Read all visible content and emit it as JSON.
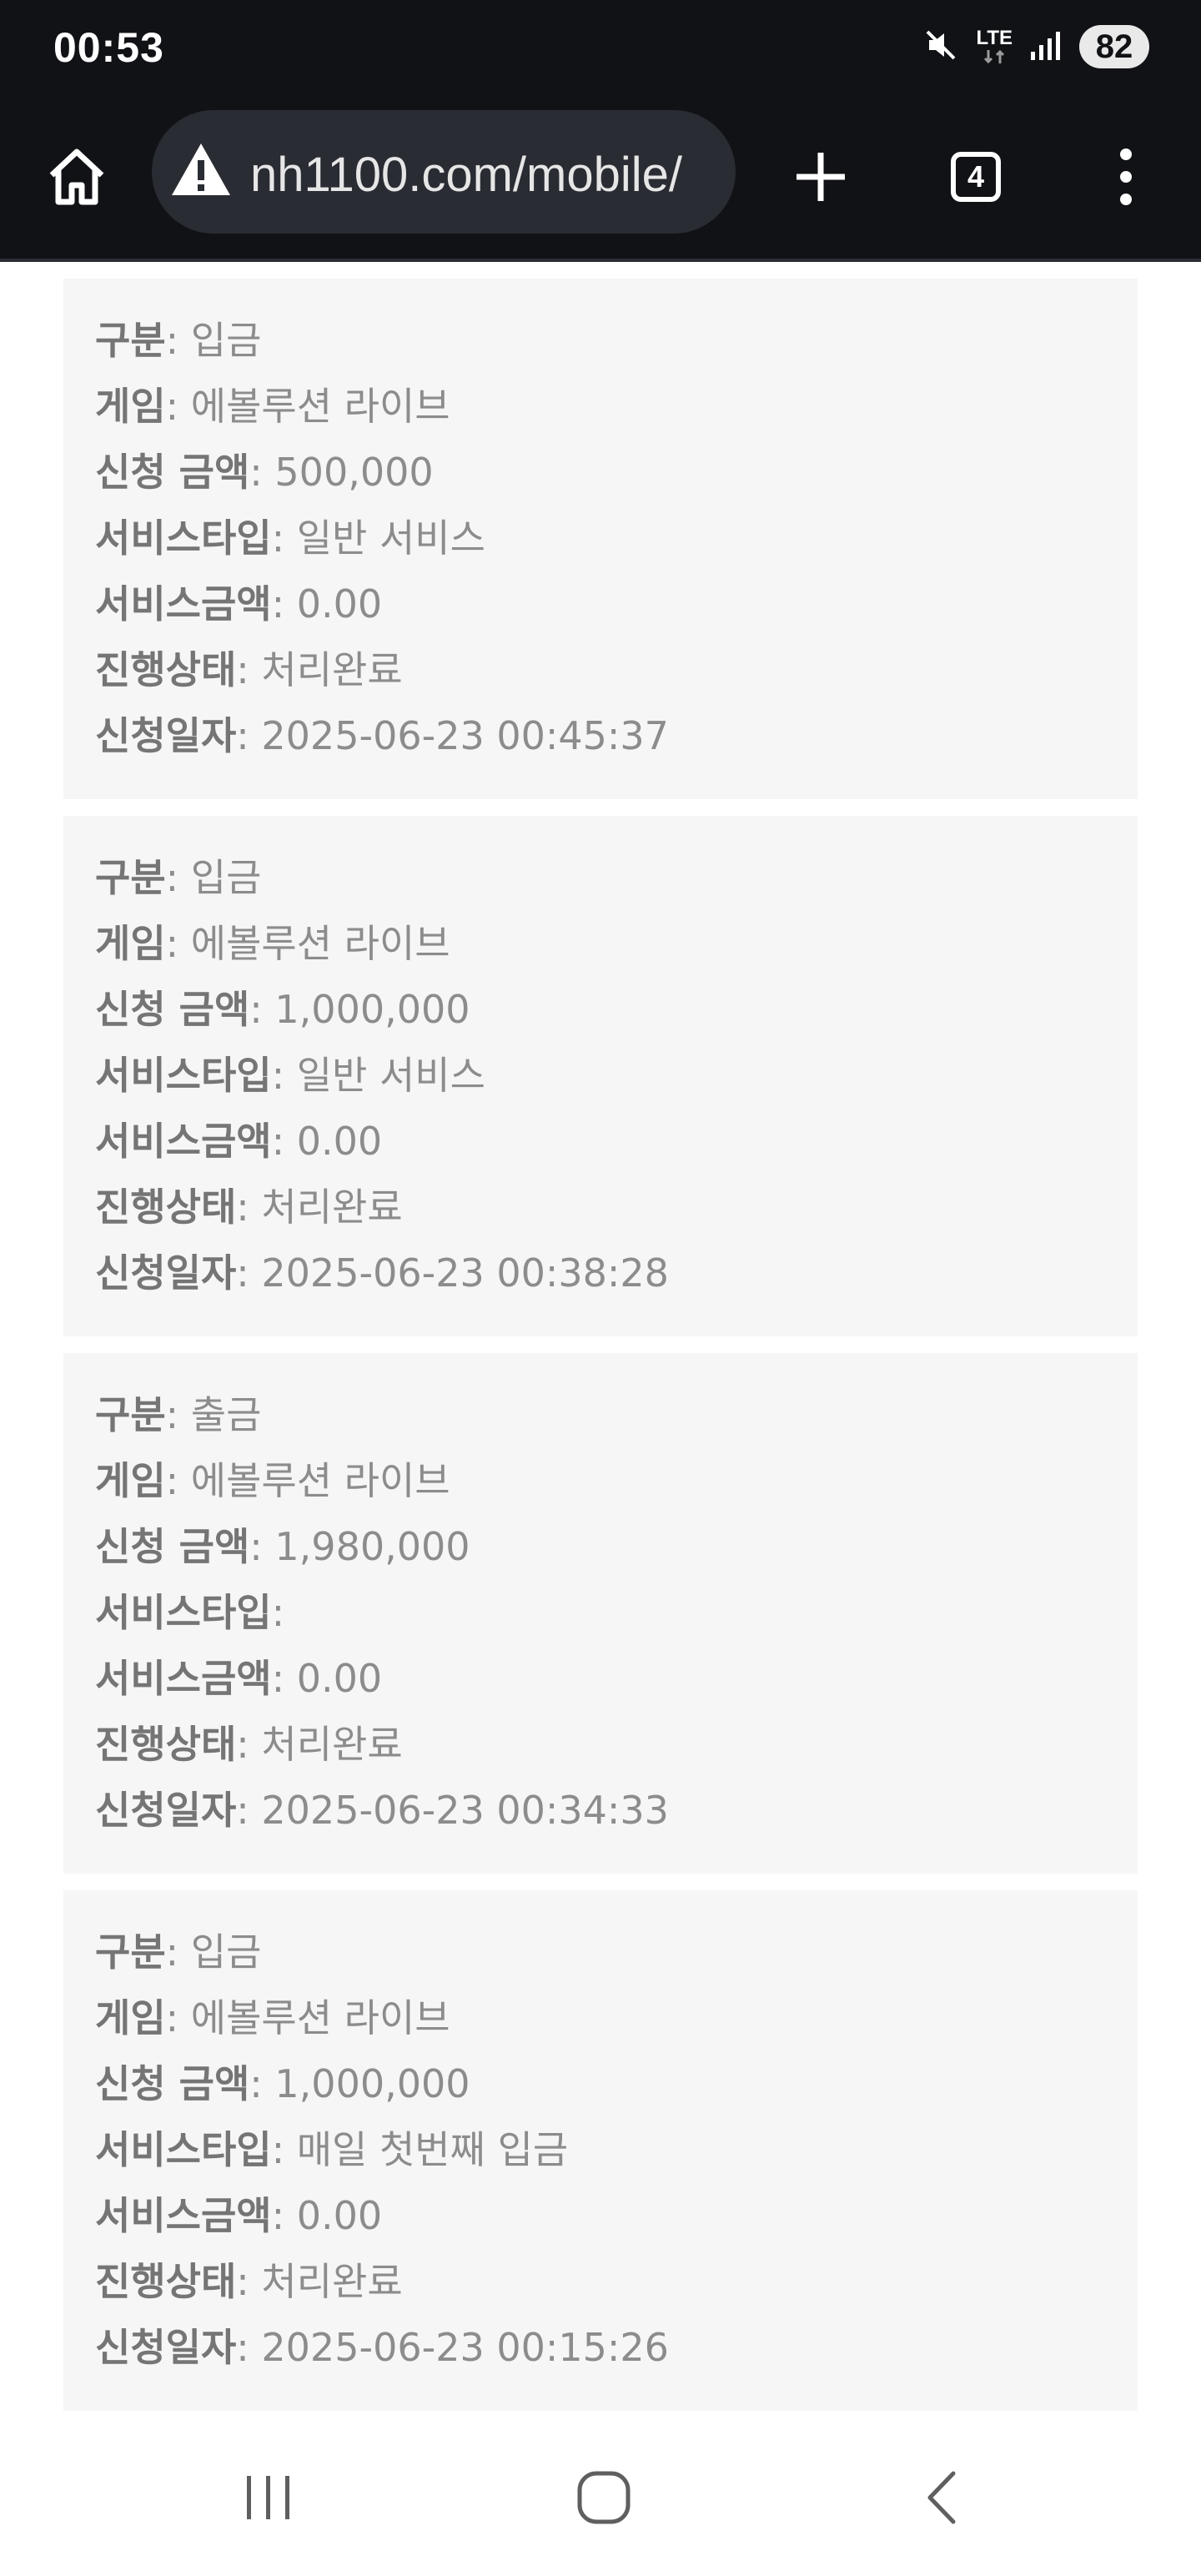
{
  "status_bar": {
    "time": "00:53",
    "network": "LTE",
    "battery": "82",
    "icons": [
      "mute-icon",
      "lte-icon",
      "signal-icon",
      "battery-icon"
    ]
  },
  "browser": {
    "url": "nh1100.com/mobile/",
    "tab_count": "4",
    "icons": [
      "home-icon",
      "warning-icon",
      "plus-icon",
      "tabs-icon",
      "more-vert-icon"
    ]
  },
  "labels": {
    "type": "구분",
    "game": "게임",
    "amount": "신청 금액",
    "service_type": "서비스타입",
    "service_amount": "서비스금액",
    "status": "진행상태",
    "date": "신청일자"
  },
  "records": [
    {
      "type": ": 입금",
      "game": ": 에볼루션 라이브",
      "amount": ": 500,000",
      "service_type": ": 일반 서비스",
      "service_amount": ": 0.00",
      "status": ": 처리완료",
      "date": ": 2025-06-23 00:45:37"
    },
    {
      "type": ": 입금",
      "game": ": 에볼루션 라이브",
      "amount": ": 1,000,000",
      "service_type": ": 일반 서비스",
      "service_amount": ": 0.00",
      "status": ": 처리완료",
      "date": ": 2025-06-23 00:38:28"
    },
    {
      "type": ": 출금",
      "game": ": 에볼루션 라이브",
      "amount": ": 1,980,000",
      "service_type": ":",
      "service_amount": ": 0.00",
      "status": ": 처리완료",
      "date": ": 2025-06-23 00:34:33"
    },
    {
      "type": ": 입금",
      "game": ": 에볼루션 라이브",
      "amount": ": 1,000,000",
      "service_type": ": 매일 첫번째 입금",
      "service_amount": ": 0.00",
      "status": ": 처리완료",
      "date": ": 2025-06-23 00:15:26"
    }
  ],
  "nav": {
    "icons": [
      "recent-apps-icon",
      "home-circle-icon",
      "back-icon"
    ]
  },
  "colors": {
    "chrome_bg": "#111216",
    "url_bar_bg": "#2a2c33",
    "card_bg": "#f6f6f7",
    "label_text": "#757575",
    "value_text": "#8c8c8c"
  }
}
